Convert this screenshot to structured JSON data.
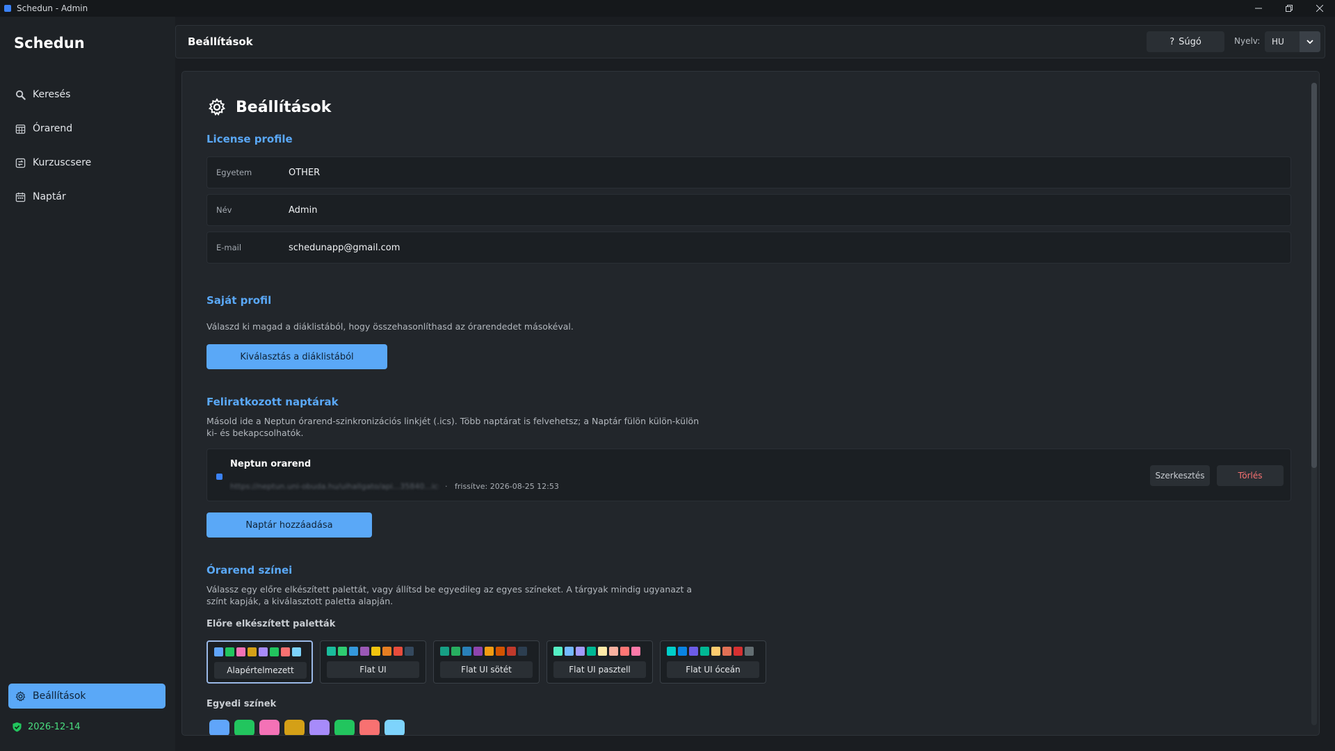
{
  "window": {
    "title": "Schedun - Admin"
  },
  "sidebar": {
    "brand": "Schedun",
    "items": [
      {
        "label": "Keresés",
        "icon": "search-icon"
      },
      {
        "label": "Órarend",
        "icon": "timetable-icon"
      },
      {
        "label": "Kurzuscsere",
        "icon": "swap-icon"
      },
      {
        "label": "Naptár",
        "icon": "calendar-icon"
      }
    ],
    "active_item": {
      "label": "Beállítások",
      "icon": "gear-icon"
    },
    "license_date": "2026-12-14"
  },
  "topbar": {
    "title": "Beállítások",
    "help_label": "Súgó",
    "help_glyph": "?",
    "language_label": "Nyelv:",
    "language_value": "HU"
  },
  "page": {
    "heading": "Beállítások",
    "license": {
      "title": "License profile",
      "rows": [
        {
          "key": "Egyetem",
          "value": "OTHER"
        },
        {
          "key": "Név",
          "value": "Admin"
        },
        {
          "key": "E-mail",
          "value": "schedunapp@gmail.com"
        }
      ]
    },
    "own_profile": {
      "title": "Saját profil",
      "description": "Válaszd ki magad a diáklistából, hogy összehasonlíthasd az órarendedet másokéval.",
      "button": "Kiválasztás a diáklistából"
    },
    "calendars": {
      "title": "Feliratkozott naptárak",
      "description_line1": "Másold ide a Neptun órarend-szinkronizációs linkjét (.ics). Több naptárat is felvehetsz; a Naptár fülön külön-külön",
      "description_line2": "ki- és bekapcsolhatók.",
      "items": [
        {
          "name": "Neptun orarend",
          "url": "https://neptun.uni-obuda.hu/uihallgato/api...35840...ics",
          "separator": "·",
          "refreshed": "frissítve: 2026-08-25 12:53",
          "edit_label": "Szerkesztés",
          "delete_label": "Törlés",
          "color": "#3b82f6"
        }
      ],
      "add_button": "Naptár hozzáadása"
    },
    "colors": {
      "title": "Órarend színei",
      "description_line1": "Válassz egy előre elkészített palettát, vagy állítsd be egyedileg az egyes színeket. A tárgyak mindig ugyanazt a",
      "description_line2": "színt kapják, a kiválasztott paletta alapján.",
      "presets_label": "Előre elkészített paletták",
      "presets": [
        {
          "name": "Alapértelmezett",
          "selected": true,
          "swatches": [
            "#60a5fa",
            "#22c55e",
            "#f472b6",
            "#d4a017",
            "#a78bfa",
            "#22c55e",
            "#f87171",
            "#7dd3fc"
          ]
        },
        {
          "name": "Flat UI",
          "selected": false,
          "swatches": [
            "#1abc9c",
            "#2ecc71",
            "#3498db",
            "#9b59b6",
            "#f1c40f",
            "#e67e22",
            "#e74c3c",
            "#34495e"
          ]
        },
        {
          "name": "Flat UI sötét",
          "selected": false,
          "swatches": [
            "#16a085",
            "#27ae60",
            "#2980b9",
            "#8e44ad",
            "#f39c12",
            "#d35400",
            "#c0392b",
            "#2c3e50"
          ]
        },
        {
          "name": "Flat UI pasztell",
          "selected": false,
          "swatches": [
            "#55efc4",
            "#74b9ff",
            "#a29bfe",
            "#00b894",
            "#ffeaa7",
            "#fab1a0",
            "#ff7675",
            "#fd79a8"
          ]
        },
        {
          "name": "Flat UI óceán",
          "selected": false,
          "swatches": [
            "#00cec9",
            "#0984e3",
            "#6c5ce7",
            "#00b894",
            "#fdcb6e",
            "#e17055",
            "#d63031",
            "#636e72"
          ]
        }
      ],
      "custom_label": "Egyedi színek",
      "custom_swatches": [
        "#60a5fa",
        "#22c55e",
        "#f472b6",
        "#d4a017",
        "#a78bfa",
        "#22c55e",
        "#f87171",
        "#7dd3fc"
      ]
    }
  }
}
